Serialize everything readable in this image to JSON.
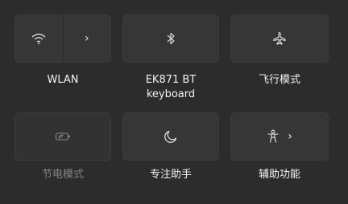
{
  "tiles": {
    "wlan": {
      "label": "WLAN",
      "icon": "wifi-icon",
      "expand": "›"
    },
    "bluetooth": {
      "label_line1": "EK871 BT",
      "label_line2": "keyboard",
      "icon": "bluetooth-icon"
    },
    "airplane": {
      "label": "飞行模式",
      "icon": "airplane-icon"
    },
    "battery_saver": {
      "label": "节电模式",
      "icon": "battery-saver-icon",
      "disabled": true
    },
    "focus_assist": {
      "label": "专注助手",
      "icon": "moon-icon"
    },
    "accessibility": {
      "label": "辅助功能",
      "icon": "accessibility-icon",
      "expand": "›"
    }
  },
  "colors": {
    "background": "#2c2c2c",
    "tile": "#363636",
    "text": "#f2f2f2",
    "text_disabled": "#858585"
  }
}
